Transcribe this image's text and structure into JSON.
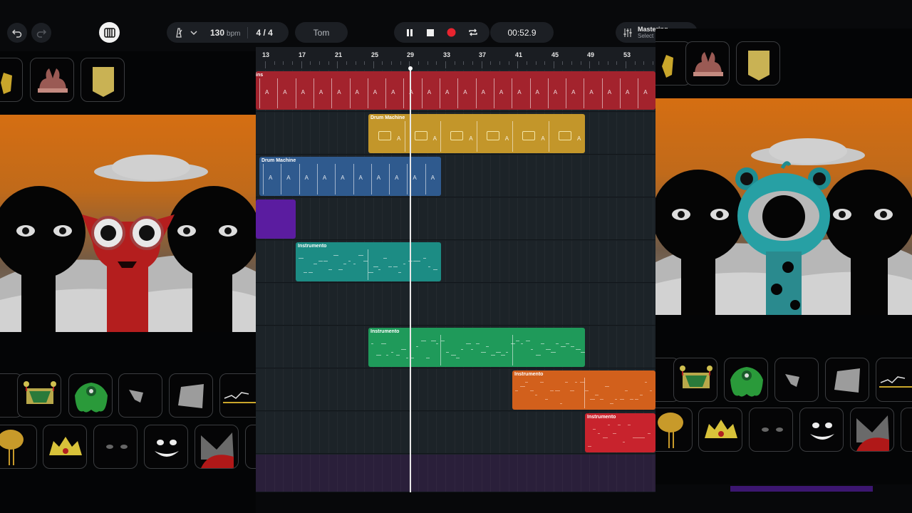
{
  "toolbar": {
    "bpm_value": "130",
    "bpm_unit": "bpm",
    "time_signature": "4 / 4",
    "preset_label": "Tom",
    "time_display": "00:52.9",
    "mastering_label": "Mastering",
    "mastering_sub": "Select"
  },
  "ruler_marks": [
    "13",
    "17",
    "21",
    "25",
    "29",
    "33",
    "37",
    "41",
    "45",
    "49",
    "53"
  ],
  "tracks": [
    {
      "clip_label": "ins",
      "color": "#a3232d"
    },
    {
      "clip_label": "Drum Machine",
      "color": "#c3962a"
    },
    {
      "clip_label": "Drum Machine",
      "color": "#2f5a8e"
    },
    {
      "clip_label": "",
      "color": "#5b1ca0"
    },
    {
      "clip_label": "Instrumento",
      "color": "#1c8c84"
    },
    {
      "clip_label": "",
      "color": "#1c2328"
    },
    {
      "clip_label": "Instrumento",
      "color": "#1f9a5a"
    },
    {
      "clip_label": "Instrumento",
      "color": "#d2601c"
    },
    {
      "clip_label": "Instrumento",
      "color": "#c8232d"
    },
    {
      "clip_label": "",
      "color": "#2a1f3a"
    }
  ],
  "clip_letter": "A",
  "colors": {
    "accent_record": "#e8242f",
    "background": "#07080a",
    "timeline": "#1b2126"
  },
  "icons": [
    "undo-icon",
    "redo-icon",
    "piano-icon",
    "metronome-icon",
    "chevron-down-icon",
    "pause-icon",
    "stop-icon",
    "record-icon",
    "loop-icon",
    "mixer-sliders-icon"
  ]
}
